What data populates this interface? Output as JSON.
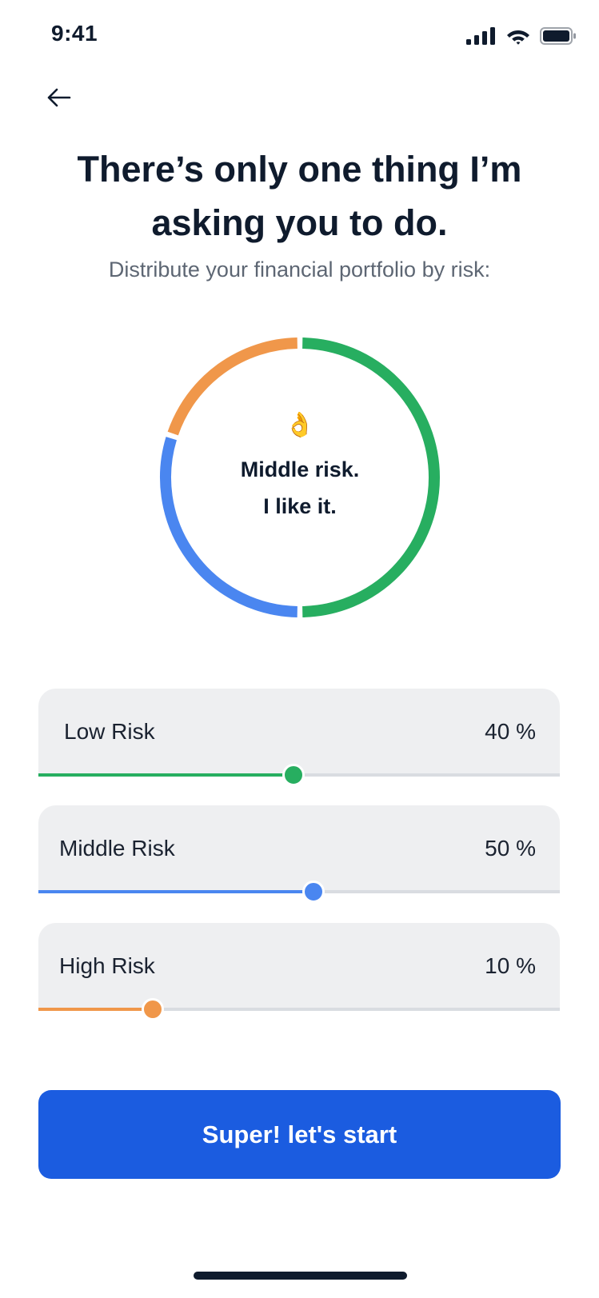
{
  "status_bar": {
    "time": "9:41",
    "icons": [
      "cellular-signal-icon",
      "wifi-icon",
      "battery-icon"
    ]
  },
  "nav": {
    "back_icon": "arrow-left-icon"
  },
  "header": {
    "title_line1": "There’s only one thing I’m",
    "title_line2": "asking you to do.",
    "subtitle": "Distribute your financial portfolio by risk:"
  },
  "ring": {
    "emoji": "👌",
    "emoji_name": "ok-hand-emoji-icon",
    "caption_line1": "Middle risk.",
    "caption_line2": "I like it.",
    "segments": [
      {
        "name": "low",
        "fraction": 0.5,
        "color": "#27ae60"
      },
      {
        "name": "middle",
        "fraction": 0.3,
        "color": "#4a86f0"
      },
      {
        "name": "high",
        "fraction": 0.2,
        "color": "#f0974a"
      }
    ]
  },
  "sliders": [
    {
      "label": "Low Risk",
      "value_text": "40 %",
      "level": 0.49,
      "color": "#27ae60"
    },
    {
      "label": "Middle Risk",
      "value_text": "50 %",
      "level": 0.527,
      "color": "#4a86f0"
    },
    {
      "label": "High Risk",
      "value_text": "10  %",
      "level": 0.22,
      "color": "#f0974a"
    }
  ],
  "cta": {
    "label": "Super! let's start",
    "color": "#1b5ce0"
  }
}
